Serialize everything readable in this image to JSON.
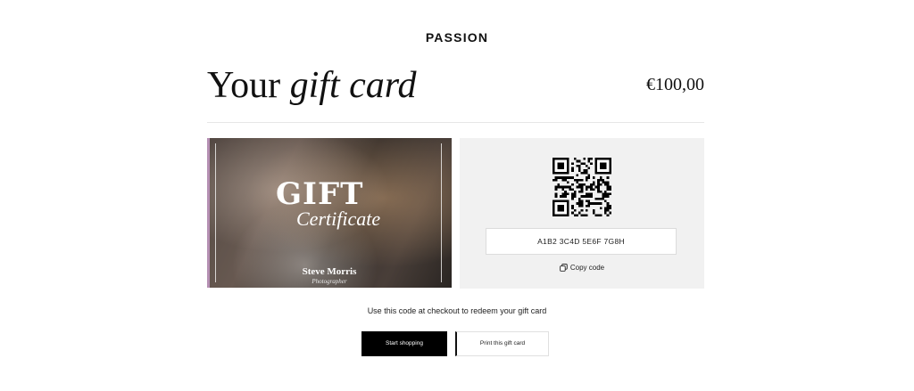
{
  "brand": "PASSION",
  "heading": {
    "prefix": "Your",
    "emphasis": "gift card"
  },
  "amount": "€100,00",
  "card": {
    "title": "GIFT",
    "subtitle": "Certificate",
    "name": "Steve Morris",
    "role": "Photographer"
  },
  "code_panel": {
    "code": "A1B2 3C4D 5E6F 7G8H",
    "copy_label": "Copy code",
    "qr_icon": "qr-code"
  },
  "hint": "Use this code at checkout to redeem your gift card",
  "actions": {
    "primary": "Start shopping",
    "secondary": "Print this gift card"
  },
  "colors": {
    "accent_bar": "#b58fb3",
    "primary_button": "#000000",
    "panel_bg": "#f1f1f1"
  }
}
